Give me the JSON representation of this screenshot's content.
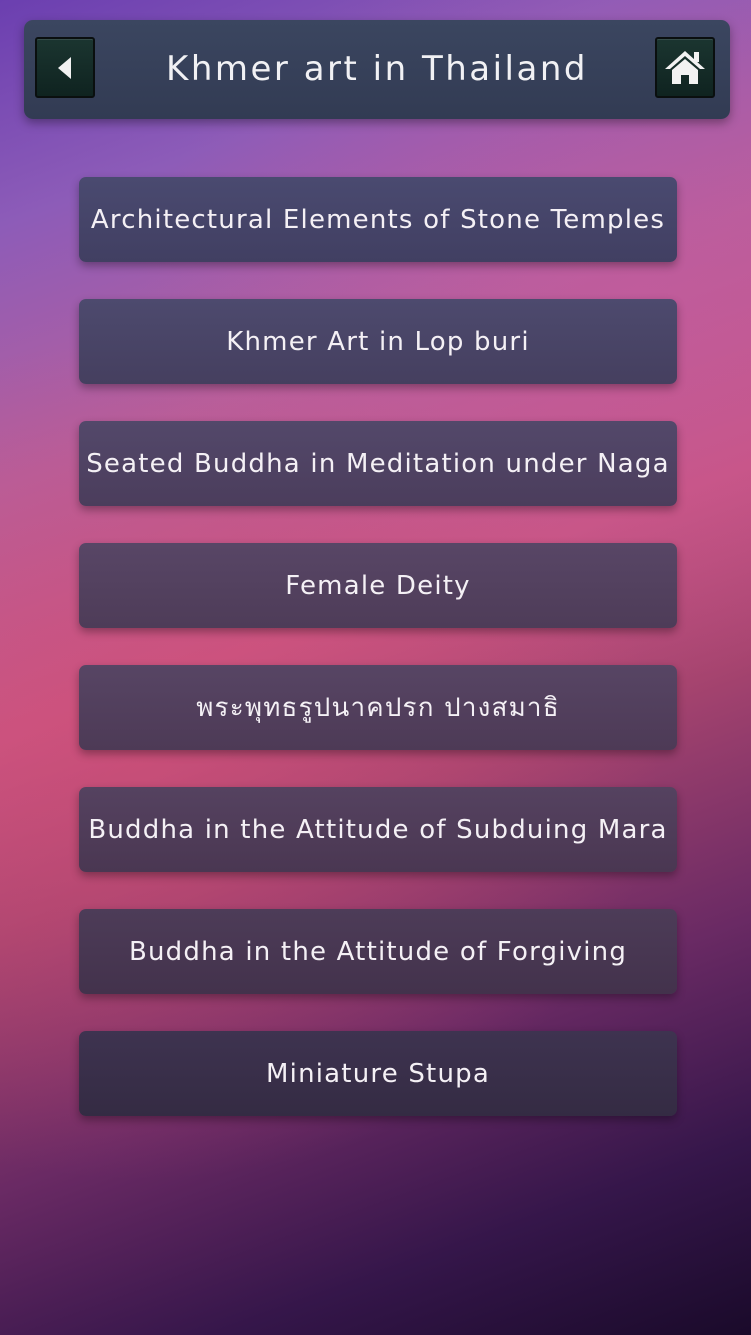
{
  "header": {
    "title": "Khmer art in Thailand",
    "back_icon": "back-arrow-icon",
    "home_icon": "home-icon"
  },
  "menu": {
    "items": [
      {
        "label": "Architectural Elements of Stone Temples"
      },
      {
        "label": "Khmer Art in Lop buri"
      },
      {
        "label": "Seated Buddha in Meditation under Naga"
      },
      {
        "label": "Female Deity"
      },
      {
        "label": "พระพุทธรูปนาคปรก ปางสมาธิ"
      },
      {
        "label": "Buddha in the Attitude of Subduing Mara"
      },
      {
        "label": "Buddha in the Attitude of Forgiving"
      },
      {
        "label": "Miniature Stupa"
      }
    ]
  },
  "colors": {
    "header_bg": "#363f58",
    "icon_button_bg": "#163028",
    "text": "#f4f0f5"
  }
}
